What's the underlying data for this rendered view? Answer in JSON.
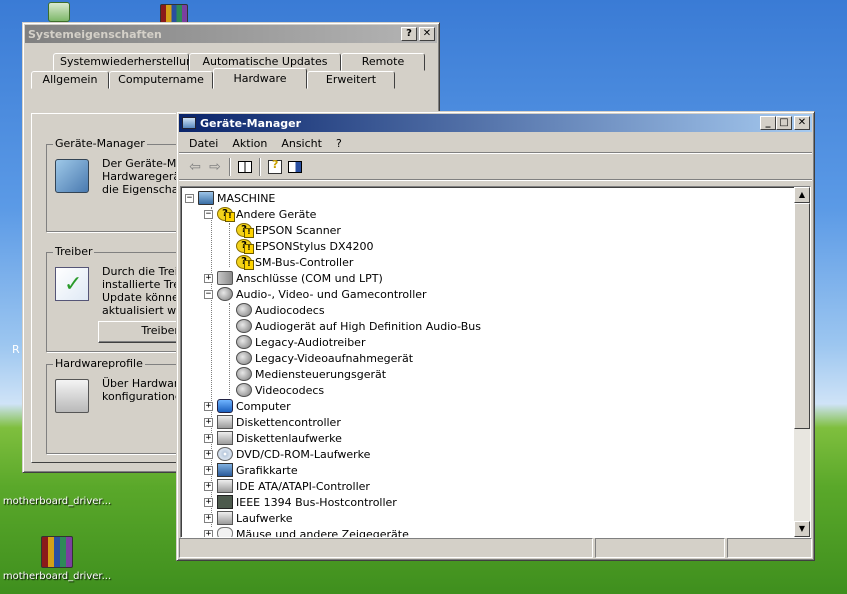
{
  "desktop": {
    "icons": [
      {
        "label": "motherboard_driver..."
      },
      {
        "label": "motherboard_driver..."
      }
    ],
    "edge_letter": "R"
  },
  "sys_window": {
    "title": "Systemeigenschaften",
    "help_btn": "?",
    "close_btn": "✕",
    "tabs_back": [
      "Systemwiederherstellung",
      "Automatische Updates",
      "Remote"
    ],
    "tabs_front": [
      "Allgemein",
      "Computername",
      "Hardware",
      "Erweitert"
    ],
    "groups": {
      "geraete": {
        "label": "Geräte-Manager",
        "text": [
          "Der Geräte-Mar",
          "Hardwaregeräte",
          "die Eigenschaft"
        ]
      },
      "treiber": {
        "label": "Treiber",
        "text": [
          "Durch die Treib",
          "installierte Treib",
          "Update könner",
          "aktualisiert werd"
        ],
        "button": "Treibersig"
      },
      "hwprofile": {
        "label": "Hardwareprofile",
        "text": [
          "Über Hardware",
          "konfigurationen"
        ]
      }
    }
  },
  "gm_window": {
    "title": "Geräte-Manager",
    "menu": [
      "Datei",
      "Aktion",
      "Ansicht",
      "?"
    ],
    "tree": [
      {
        "depth": 0,
        "exp": "−",
        "icon": "computer-icon",
        "cls": "ico-comp",
        "label": "MASCHINE"
      },
      {
        "depth": 1,
        "exp": "−",
        "icon": "unknown-device-icon",
        "cls": "ico-warn",
        "label": "Andere Geräte"
      },
      {
        "depth": 2,
        "exp": "",
        "icon": "warning-device-icon",
        "cls": "ico-warn",
        "label": "EPSON Scanner"
      },
      {
        "depth": 2,
        "exp": "",
        "icon": "warning-device-icon",
        "cls": "ico-warn",
        "label": "EPSONStylus DX4200"
      },
      {
        "depth": 2,
        "exp": "",
        "icon": "warning-device-icon",
        "cls": "ico-warn",
        "label": "SM-Bus-Controller"
      },
      {
        "depth": 1,
        "exp": "+",
        "icon": "port-icon",
        "cls": "ico-port",
        "label": "Anschlüsse (COM und LPT)"
      },
      {
        "depth": 1,
        "exp": "−",
        "icon": "speaker-icon",
        "cls": "ico-speaker",
        "label": "Audio-, Video- und Gamecontroller"
      },
      {
        "depth": 2,
        "exp": "",
        "icon": "speaker-icon",
        "cls": "ico-speaker",
        "label": "Audiocodecs"
      },
      {
        "depth": 2,
        "exp": "",
        "icon": "speaker-warning-icon",
        "cls": "ico-speaker",
        "label": "Audiogerät auf High Definition Audio-Bus"
      },
      {
        "depth": 2,
        "exp": "",
        "icon": "speaker-icon",
        "cls": "ico-speaker",
        "label": "Legacy-Audiotreiber"
      },
      {
        "depth": 2,
        "exp": "",
        "icon": "speaker-icon",
        "cls": "ico-speaker",
        "label": "Legacy-Videoaufnahmegerät"
      },
      {
        "depth": 2,
        "exp": "",
        "icon": "speaker-icon",
        "cls": "ico-speaker",
        "label": "Mediensteuerungsgerät"
      },
      {
        "depth": 2,
        "exp": "",
        "icon": "speaker-icon",
        "cls": "ico-speaker",
        "label": "Videocodecs"
      },
      {
        "depth": 1,
        "exp": "+",
        "icon": "computer-icon",
        "cls": "ico-comp2",
        "label": "Computer"
      },
      {
        "depth": 1,
        "exp": "+",
        "icon": "floppy-controller-icon",
        "cls": "ico-drive",
        "label": "Diskettencontroller"
      },
      {
        "depth": 1,
        "exp": "+",
        "icon": "floppy-drive-icon",
        "cls": "ico-drive",
        "label": "Diskettenlaufwerke"
      },
      {
        "depth": 1,
        "exp": "+",
        "icon": "cd-drive-icon",
        "cls": "ico-disc",
        "label": "DVD/CD-ROM-Laufwerke"
      },
      {
        "depth": 1,
        "exp": "+",
        "icon": "display-adapter-icon",
        "cls": "ico-display",
        "label": "Grafikkarte"
      },
      {
        "depth": 1,
        "exp": "+",
        "icon": "ide-controller-icon",
        "cls": "ico-drive",
        "label": "IDE ATA/ATAPI-Controller"
      },
      {
        "depth": 1,
        "exp": "+",
        "icon": "ieee1394-icon",
        "cls": "ico-chip",
        "label": "IEEE 1394 Bus-Hostcontroller"
      },
      {
        "depth": 1,
        "exp": "+",
        "icon": "disk-drive-icon",
        "cls": "ico-drive",
        "label": "Laufwerke"
      },
      {
        "depth": 1,
        "exp": "+",
        "icon": "mouse-icon",
        "cls": "ico-mouse",
        "label": "Mäuse und andere Zeigegeräte"
      }
    ]
  }
}
